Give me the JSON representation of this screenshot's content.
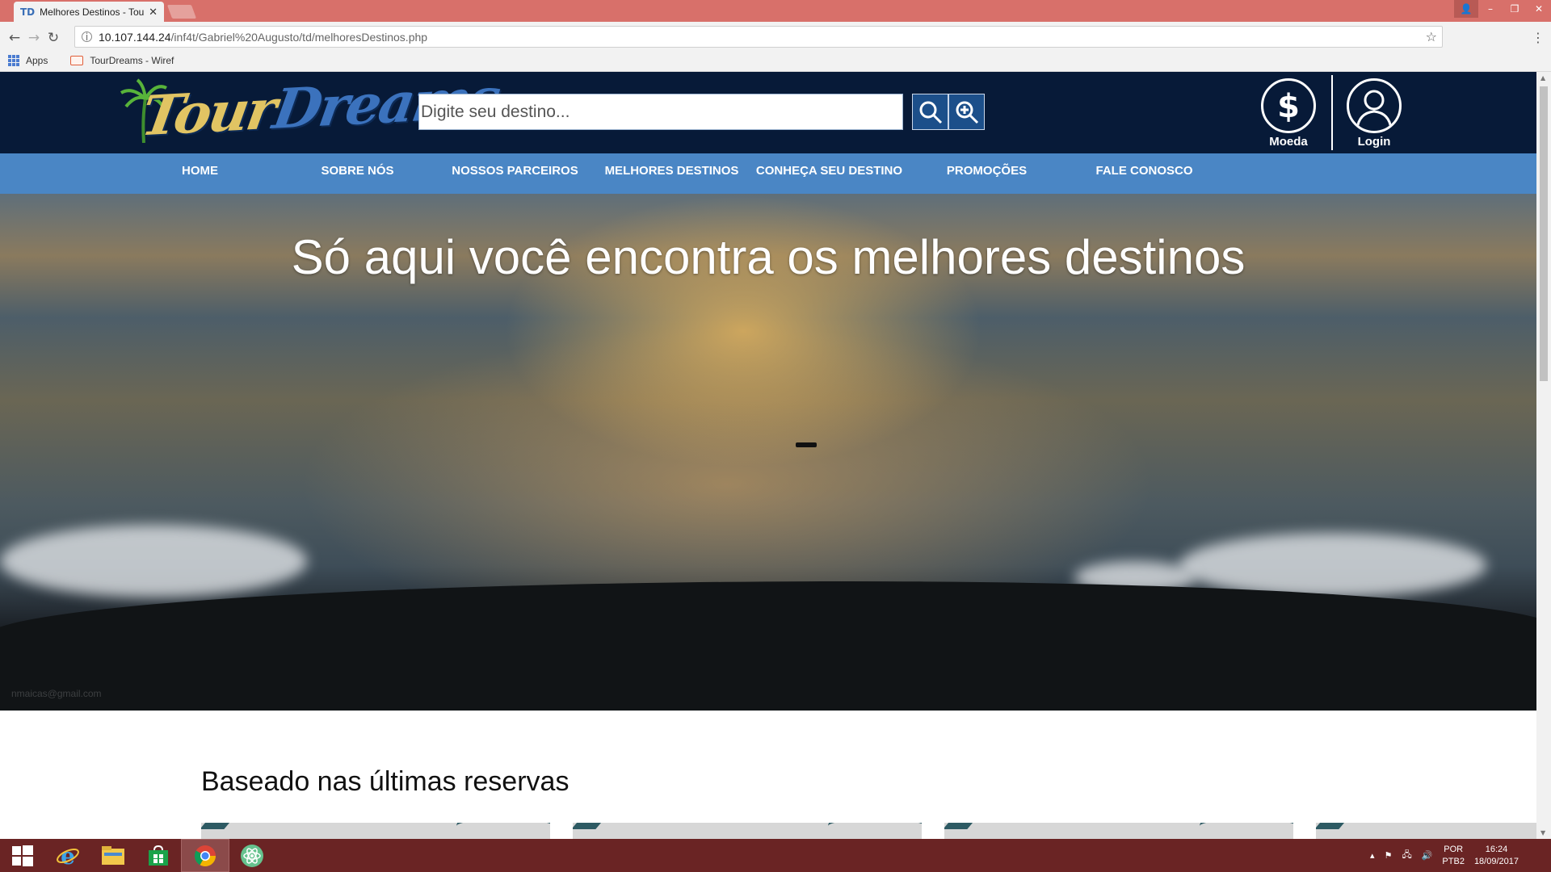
{
  "browser": {
    "tab_title": "Melhores Destinos - Tou",
    "tab_favicon": "TD",
    "url_host": "10.107.144.24",
    "url_path": "/inf4t/Gabriel%20Augusto/td/melhoresDestinos.php",
    "bookmarks": [
      {
        "label": "Apps",
        "icon": "apps-grid-icon"
      },
      {
        "label": "TourDreams - Wiref",
        "icon": "bookmark-page-icon"
      }
    ]
  },
  "site": {
    "logo_text_a": "Tour",
    "logo_text_b": "Dreams",
    "search_placeholder": "Digite seu destino...",
    "header_icons": [
      {
        "label": "Moeda",
        "icon": "dollar-icon"
      },
      {
        "label": "Login",
        "icon": "user-icon"
      }
    ],
    "nav": [
      "HOME",
      "SOBRE NÓS",
      "NOSSOS PARCEIROS",
      "MELHORES DESTINOS",
      "CONHEÇA SEU DESTINO",
      "PROMOÇÕES",
      "FALE CONOSCO"
    ],
    "hero_title": "Só aqui você encontra os melhores destinos",
    "hero_watermark": "nmaicas@gmail.com",
    "section_title": "Baseado nas últimas reservas"
  },
  "taskbar": {
    "apps": [
      "windows-start-icon",
      "internet-explorer-icon",
      "file-explorer-icon",
      "store-icon",
      "chrome-icon",
      "atom-icon"
    ],
    "lang_top": "POR",
    "lang_bottom": "PTB2",
    "time": "16:24",
    "date": "18/09/2017"
  },
  "colors": {
    "titlebar": "#d8706a",
    "header": "#071a38",
    "nav": "#4a86c5",
    "taskbar": "#6a2424"
  }
}
